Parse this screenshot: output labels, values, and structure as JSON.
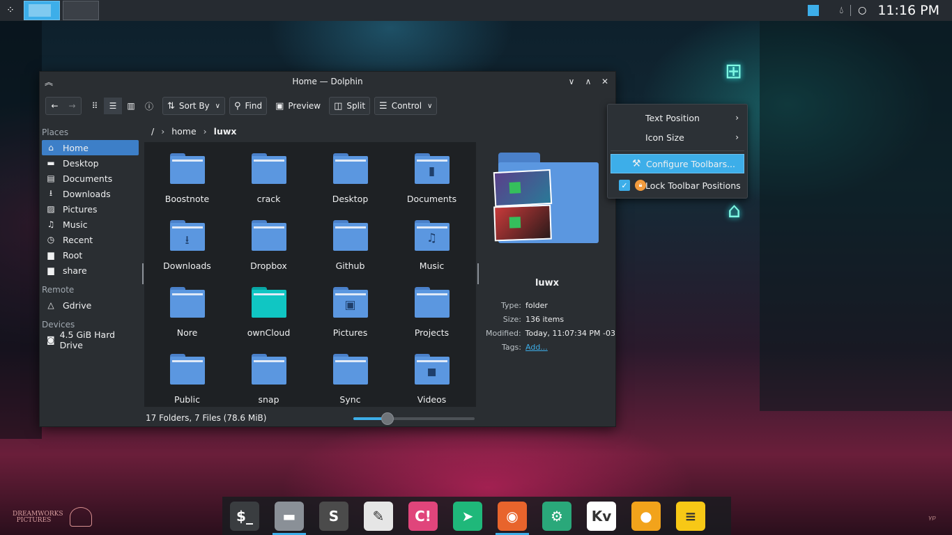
{
  "top_panel": {
    "clock": "11:16 PM",
    "tray_icons": [
      "drop-icon",
      "circle-icon"
    ]
  },
  "window": {
    "title": "Home — Dolphin",
    "toolbar": {
      "sort_label": "Sort By",
      "find_label": "Find",
      "preview_label": "Preview",
      "split_label": "Split",
      "control_label": "Control"
    },
    "places": {
      "places_header": "Places",
      "items": [
        {
          "label": "Home",
          "icon": "home-icon"
        },
        {
          "label": "Desktop",
          "icon": "desktop-icon"
        },
        {
          "label": "Documents",
          "icon": "documents-icon"
        },
        {
          "label": "Downloads",
          "icon": "downloads-icon"
        },
        {
          "label": "Pictures",
          "icon": "pictures-icon"
        },
        {
          "label": "Music",
          "icon": "music-icon"
        },
        {
          "label": "Recent",
          "icon": "recent-icon"
        },
        {
          "label": "Root",
          "icon": "root-folder-icon"
        },
        {
          "label": "share",
          "icon": "share-folder-icon"
        }
      ],
      "remote_header": "Remote",
      "remote_items": [
        {
          "label": "Gdrive",
          "icon": "gdrive-icon"
        }
      ],
      "devices_header": "Devices",
      "device_items": [
        {
          "label": "4.5 GiB Hard Drive",
          "icon": "hard-drive-icon"
        }
      ]
    },
    "breadcrumb": {
      "root": "/",
      "home": "home",
      "current": "luwx"
    },
    "files": [
      {
        "name": "Boostnote",
        "emblem": ""
      },
      {
        "name": "crack",
        "emblem": ""
      },
      {
        "name": "Desktop",
        "emblem": ""
      },
      {
        "name": "Documents",
        "emblem": "document"
      },
      {
        "name": "Downloads",
        "emblem": "download"
      },
      {
        "name": "Dropbox",
        "emblem": ""
      },
      {
        "name": "Github",
        "emblem": ""
      },
      {
        "name": "Music",
        "emblem": "music"
      },
      {
        "name": "Nore",
        "emblem": ""
      },
      {
        "name": "ownCloud",
        "emblem": "teal"
      },
      {
        "name": "Pictures",
        "emblem": "picture"
      },
      {
        "name": "Projects",
        "emblem": ""
      },
      {
        "name": "Public",
        "emblem": ""
      },
      {
        "name": "snap",
        "emblem": ""
      },
      {
        "name": "Sync",
        "emblem": ""
      },
      {
        "name": "Videos",
        "emblem": "video"
      }
    ],
    "info_panel": {
      "name": "luwx",
      "type_key": "Type:",
      "type_value": "folder",
      "size_key": "Size:",
      "size_value": "136 items",
      "modified_key": "Modified:",
      "modified_value": "Today, 11:07:34 PM -03",
      "tags_key": "Tags:",
      "tags_value": "Add..."
    },
    "status": {
      "text": "17 Folders, 7 Files (78.6 MiB)",
      "zoom_fraction": 0.28
    }
  },
  "context_menu": {
    "text_position": "Text Position",
    "icon_size": "Icon Size",
    "configure_toolbars": "Configure Toolbars...",
    "lock_toolbar": "Lock Toolbar Positions",
    "lock_checked": true
  },
  "dock": {
    "apps": [
      {
        "name": "terminal",
        "icon": "terminal-icon",
        "glyph": "$_",
        "color": "#3a3d40",
        "running": false
      },
      {
        "name": "file-manager",
        "icon": "file-manager-icon",
        "glyph": "▬",
        "color": "#8a9097",
        "running": true
      },
      {
        "name": "sublime-text",
        "icon": "sublime-icon",
        "glyph": "S",
        "color": "#4b4b4b",
        "running": false
      },
      {
        "name": "text-editor",
        "icon": "text-editor-icon",
        "glyph": "✎",
        "color": "#e6e6e6",
        "running": false
      },
      {
        "name": "clipgrab",
        "icon": "clip-icon",
        "glyph": "C!",
        "color": "#e0457b",
        "running": false
      },
      {
        "name": "telegram",
        "icon": "telegram-icon",
        "glyph": "➤",
        "color": "#1fb87a",
        "running": false
      },
      {
        "name": "firefox",
        "icon": "firefox-icon",
        "glyph": "◉",
        "color": "#e8642c",
        "running": true
      },
      {
        "name": "system-settings",
        "icon": "settings-icon",
        "glyph": "⚙",
        "color": "#2aa87a",
        "running": false
      },
      {
        "name": "kvantum",
        "icon": "kvantum-icon",
        "glyph": "Kv",
        "color": "#ffffff",
        "running": false
      },
      {
        "name": "unknown-app",
        "icon": "orange-circle-icon",
        "glyph": "●",
        "color": "#f2a31b",
        "running": false
      },
      {
        "name": "notes",
        "icon": "sticky-notes-icon",
        "glyph": "≡",
        "color": "#f7c816",
        "running": false
      }
    ]
  },
  "desktop": {
    "dreamworks_logo": "DreamWorks PICTURES"
  }
}
